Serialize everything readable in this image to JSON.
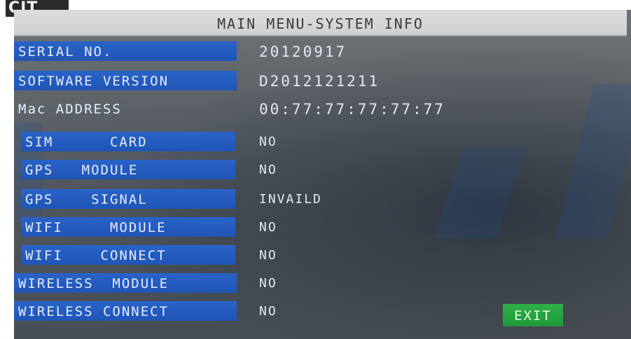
{
  "header": {
    "logo_text": "CIT",
    "title": "MAIN MENU-SYSTEM INFO"
  },
  "info_rows": [
    {
      "label": "SERIAL NO.",
      "value": "20120917"
    },
    {
      "label": "SOFTWARE VERSION",
      "value": "D2012121211"
    },
    {
      "label": "Mac ADDRESS",
      "value": "00:77:77:77:77:77"
    },
    {
      "label": "SIM      CARD",
      "value": "NO"
    },
    {
      "label": "GPS   MODULE",
      "value": "NO"
    },
    {
      "label": "GPS    SIGNAL",
      "value": "INVAILD"
    },
    {
      "label": "WIFI     MODULE",
      "value": "NO"
    },
    {
      "label": "WIFI    CONNECT",
      "value": "NO"
    },
    {
      "label": "WIRELESS  MODULE",
      "value": "NO"
    },
    {
      "label": "WIRELESS CONNECT",
      "value": "NO"
    }
  ],
  "actions": {
    "exit_label": "EXIT"
  },
  "colors": {
    "label_background": "#2a63c8",
    "title_bar": "#d6d6d6",
    "exit_button": "#27a642"
  }
}
